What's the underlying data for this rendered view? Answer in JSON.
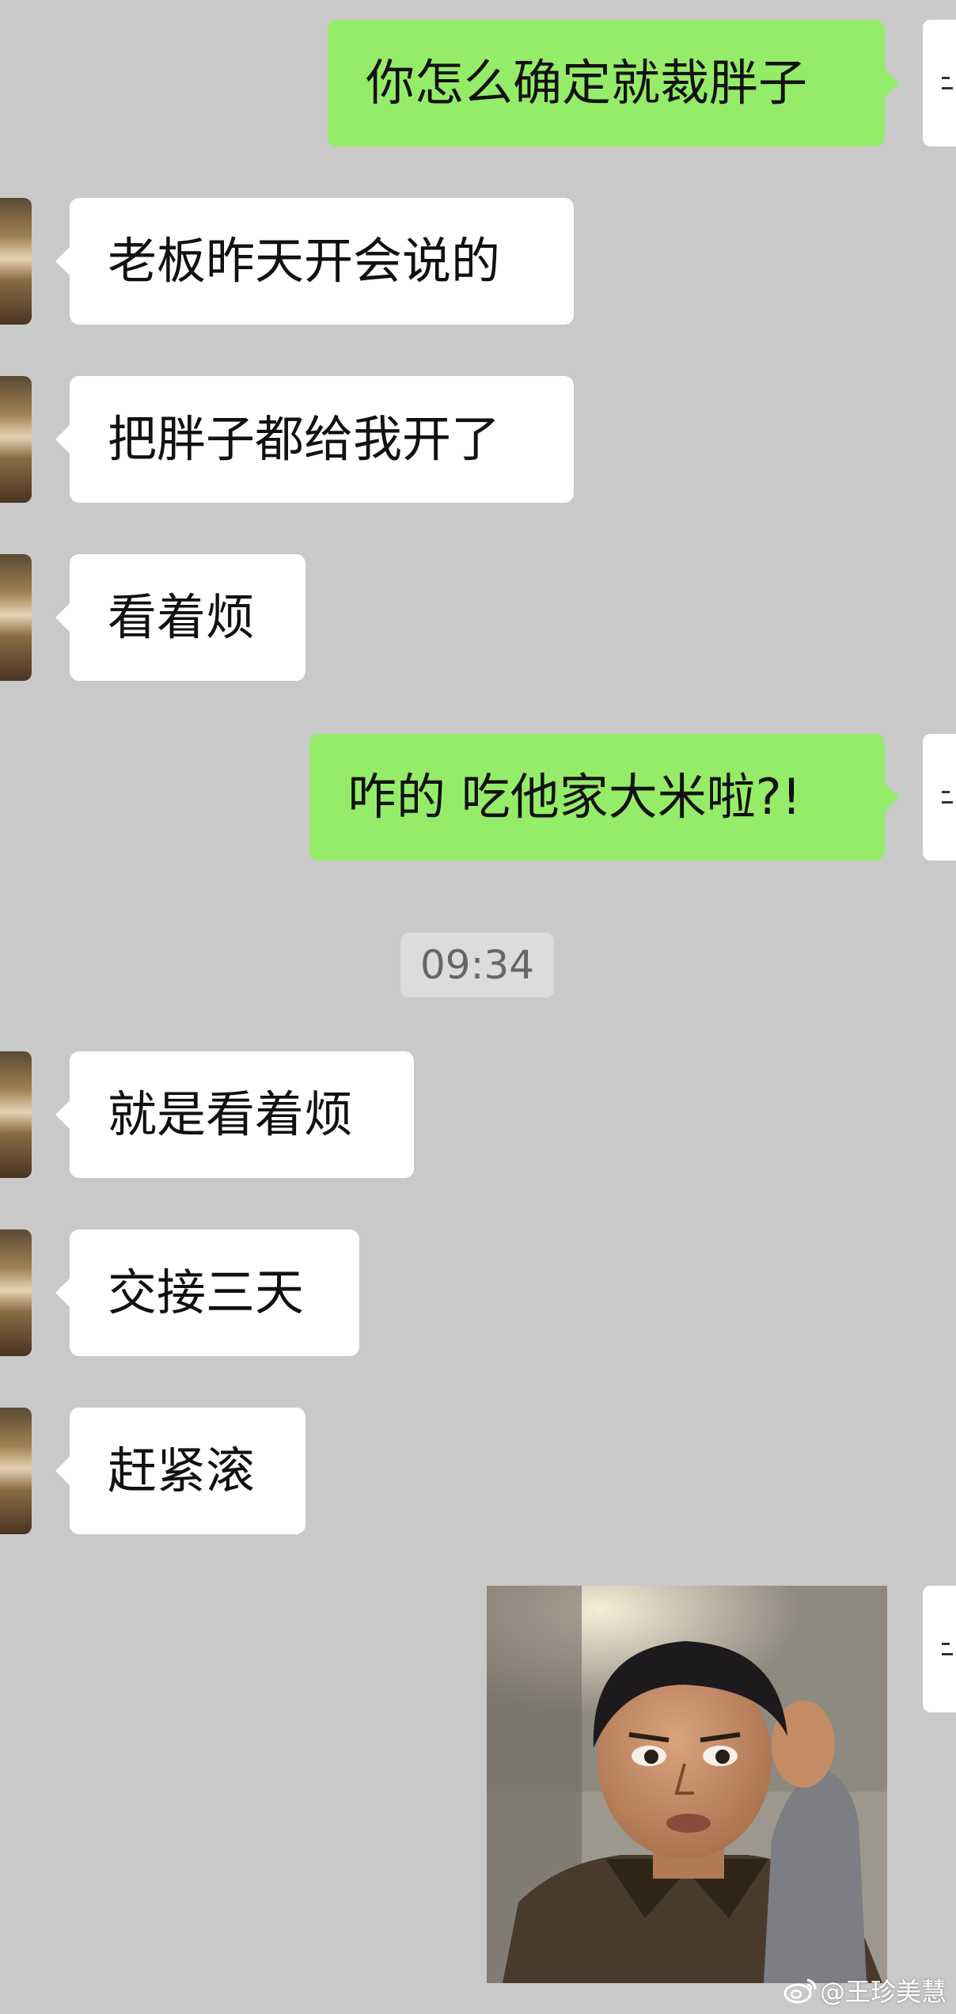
{
  "messages": [
    {
      "side": "out",
      "text": "你怎么确定就裁胖子"
    },
    {
      "side": "in",
      "text": "老板昨天开会说的"
    },
    {
      "side": "in",
      "text": "把胖子都给我开了"
    },
    {
      "side": "in",
      "text": "看着烦"
    },
    {
      "side": "out",
      "text": "咋的 吃他家大米啦?!"
    },
    {
      "side": "in",
      "text": "就是看着烦"
    },
    {
      "side": "in",
      "text": "交接三天"
    },
    {
      "side": "in",
      "text": "赶紧滚"
    }
  ],
  "timestamp": "09:34",
  "sticker": {
    "icon": "man-thinking-sticker"
  },
  "watermark": {
    "text": "@王珍美慧",
    "icon": "weibo-icon"
  },
  "colors": {
    "background": "#c9c9c9",
    "outgoing_bubble": "#95ec69",
    "incoming_bubble": "#ffffff"
  }
}
